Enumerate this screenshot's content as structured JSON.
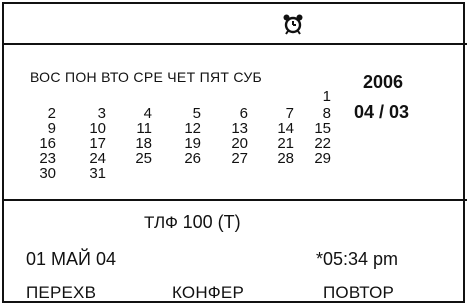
{
  "header": {
    "icon": "alarm-clock-icon"
  },
  "calendar": {
    "weekdays": "ВОС ПОН ВТО СРЕ ЧЕТ ПЯТ СУБ",
    "weeks": [
      [
        "",
        "",
        "",
        "",
        "",
        "",
        "1"
      ],
      [
        "2",
        "3",
        "4",
        "5",
        "6",
        "7",
        "8"
      ],
      [
        "9",
        "10",
        "11",
        "12",
        "13",
        "14",
        "15"
      ],
      [
        "16",
        "17",
        "18",
        "19",
        "20",
        "21",
        "22"
      ],
      [
        "23",
        "24",
        "25",
        "26",
        "27",
        "28",
        "29"
      ],
      [
        "30",
        "31",
        "",
        "",
        "",
        "",
        ""
      ]
    ],
    "year": "2006",
    "month_day": "04 / 03"
  },
  "status": {
    "line_label": "ТЛФ",
    "line_number": "100 (T)",
    "date": "01 МАЙ 04",
    "time": "*05:34 pm"
  },
  "softkeys": [
    "ПЕРЕХВ",
    "КОНФЕР",
    "ПОВТОР"
  ]
}
